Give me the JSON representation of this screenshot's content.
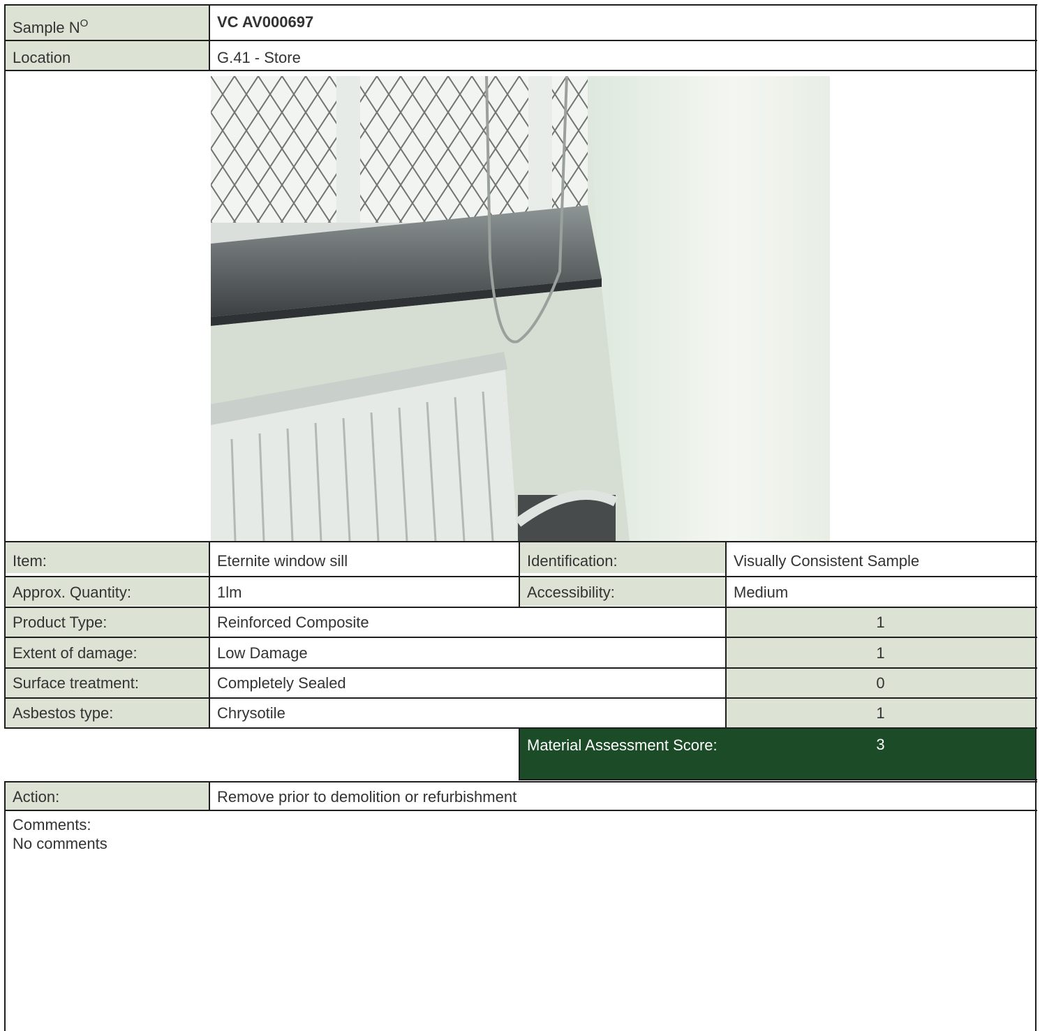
{
  "header": {
    "sample_label": "Sample N",
    "sample_sup": "O",
    "sample_value": "VC AV000697",
    "location_label": "Location",
    "location_value": "G.41 - Store"
  },
  "photo": {
    "icon": "window-sill-radiator-photo"
  },
  "details": {
    "item_label": "Item:",
    "item_value": "Eternite window sill",
    "identification_label": "Identification:",
    "identification_value": "Visually Consistent Sample",
    "quantity_label": "Approx. Quantity:",
    "quantity_value": "1lm",
    "accessibility_label": "Accessibility:",
    "accessibility_value": "Medium"
  },
  "scores": [
    {
      "label": "Product Type:",
      "value": "Reinforced Composite",
      "score": "1"
    },
    {
      "label": "Extent of damage:",
      "value": "Low Damage",
      "score": "1"
    },
    {
      "label": "Surface treatment:",
      "value": "Completely Sealed",
      "score": "0"
    },
    {
      "label": "Asbestos type:",
      "value": "Chrysotile",
      "score": "1"
    }
  ],
  "material_assessment": {
    "label": "Material Assessment Score:",
    "score": "3"
  },
  "action": {
    "label": "Action:",
    "value": "Remove prior to demolition or refurbishment"
  },
  "comments": {
    "label": "Comments:",
    "value": "No comments"
  },
  "colors": {
    "label_bg": "#dde3d4",
    "score_bg": "#1b4b27",
    "border": "#1e1e1e"
  }
}
